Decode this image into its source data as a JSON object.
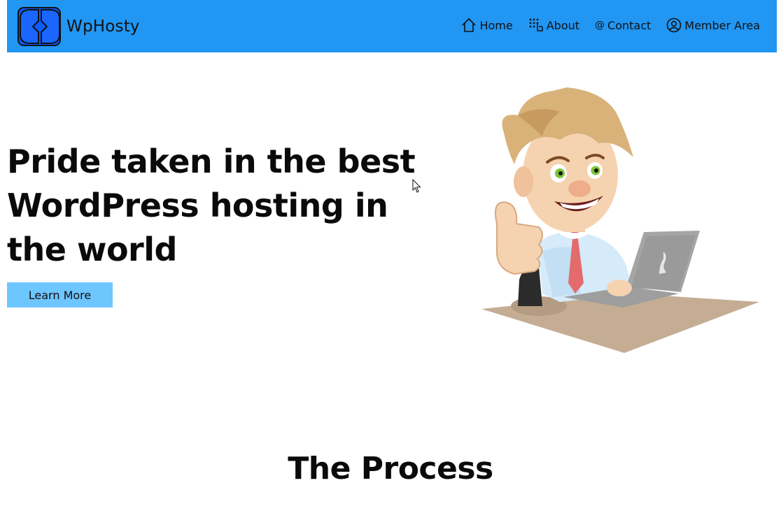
{
  "header": {
    "brand": "WpHosty",
    "nav": [
      {
        "label": "Home",
        "icon": "home-icon"
      },
      {
        "label": "About",
        "icon": "pointer-dots-icon"
      },
      {
        "label": "Contact",
        "icon": "at-icon"
      },
      {
        "label": "Member Area",
        "icon": "user-circle-icon"
      }
    ]
  },
  "hero": {
    "title": "Pride taken in the best WordPress hosting in the world",
    "button": "Learn More"
  },
  "process": {
    "title": "The Process"
  },
  "colors": {
    "nav_bg": "#2196f3",
    "button_bg": "#6ec6ff",
    "logo_fill": "#1565ff"
  }
}
